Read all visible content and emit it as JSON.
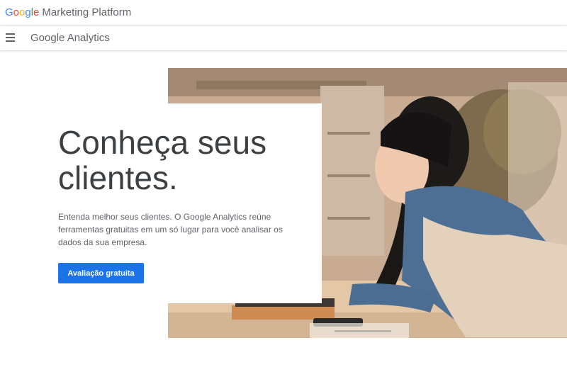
{
  "header": {
    "brand_logo_letters": [
      "G",
      "o",
      "o",
      "g",
      "l",
      "e"
    ],
    "brand_product": "Marketing Platform",
    "app_title": "Google Analytics"
  },
  "hero": {
    "headline": "Conheça seus clientes.",
    "description": "Entenda melhor seus clientes. O Google Analytics reúne ferramentas gratuitas em um só lugar para você analisar os dados da sua empresa.",
    "cta_label": "Avaliação gratuita"
  },
  "colors": {
    "accent": "#1a73e8",
    "google_blue": "#4285f4",
    "google_red": "#ea4335",
    "google_yellow": "#fbbc05",
    "google_green": "#34a853"
  },
  "icons": [
    "hamburger-menu-icon"
  ]
}
